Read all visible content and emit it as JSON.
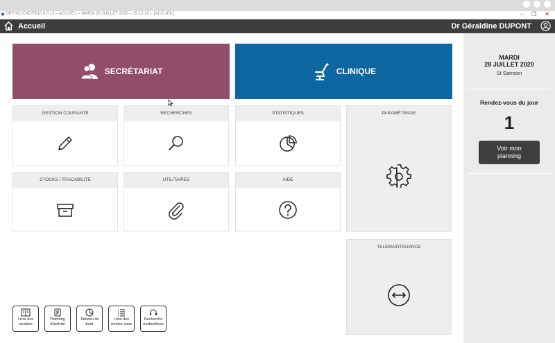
{
  "window": {
    "title": "ORTHOLEADER10.6.0.13 – ACCUEIL – MARDI 28 JUILLET 2020 – 15:12:20 – [ACCUEIL]",
    "controls": [
      "–",
      "❐",
      "✕"
    ]
  },
  "appbar": {
    "title": "Accueil",
    "user": "Dr Géraldine DUPONT"
  },
  "main": {
    "secretariat_label": "SECRÉTARIAT",
    "clinique_label": "CLINIQUE",
    "tiles": {
      "gestion": "GESTION COURANTE",
      "recherches": "RECHERCHES",
      "statistiques": "STATISTIQUES",
      "parametrage": "PARAMÉTRAGE",
      "stocks": "STOCKS / TRACABILITE",
      "utilitaires": "UTILITAIRES",
      "aide": "AIDE",
      "telemaintenance": "TELEMAINTENANCE"
    }
  },
  "shortcuts": [
    {
      "line1": "Livre des",
      "line2": "recettes"
    },
    {
      "line1": "Planning",
      "line2": "d'activité"
    },
    {
      "line1": "Tableau de",
      "line2": "bord"
    },
    {
      "line1": "Liste des",
      "line2": "rendez-vous"
    },
    {
      "line1": "Recherche",
      "line2": "multicritères"
    }
  ],
  "side": {
    "day": "MARDI",
    "date": "28 JUILLET 2020",
    "place": "St Samson",
    "rdv_label": "Rendez-vous du jour",
    "rdv_count": "1",
    "planning_line1": "Voir mon",
    "planning_line2": "planning"
  },
  "colors": {
    "secretariat": "#924d6a",
    "clinique": "#0f67a1",
    "appbar": "#3d3d3d"
  }
}
